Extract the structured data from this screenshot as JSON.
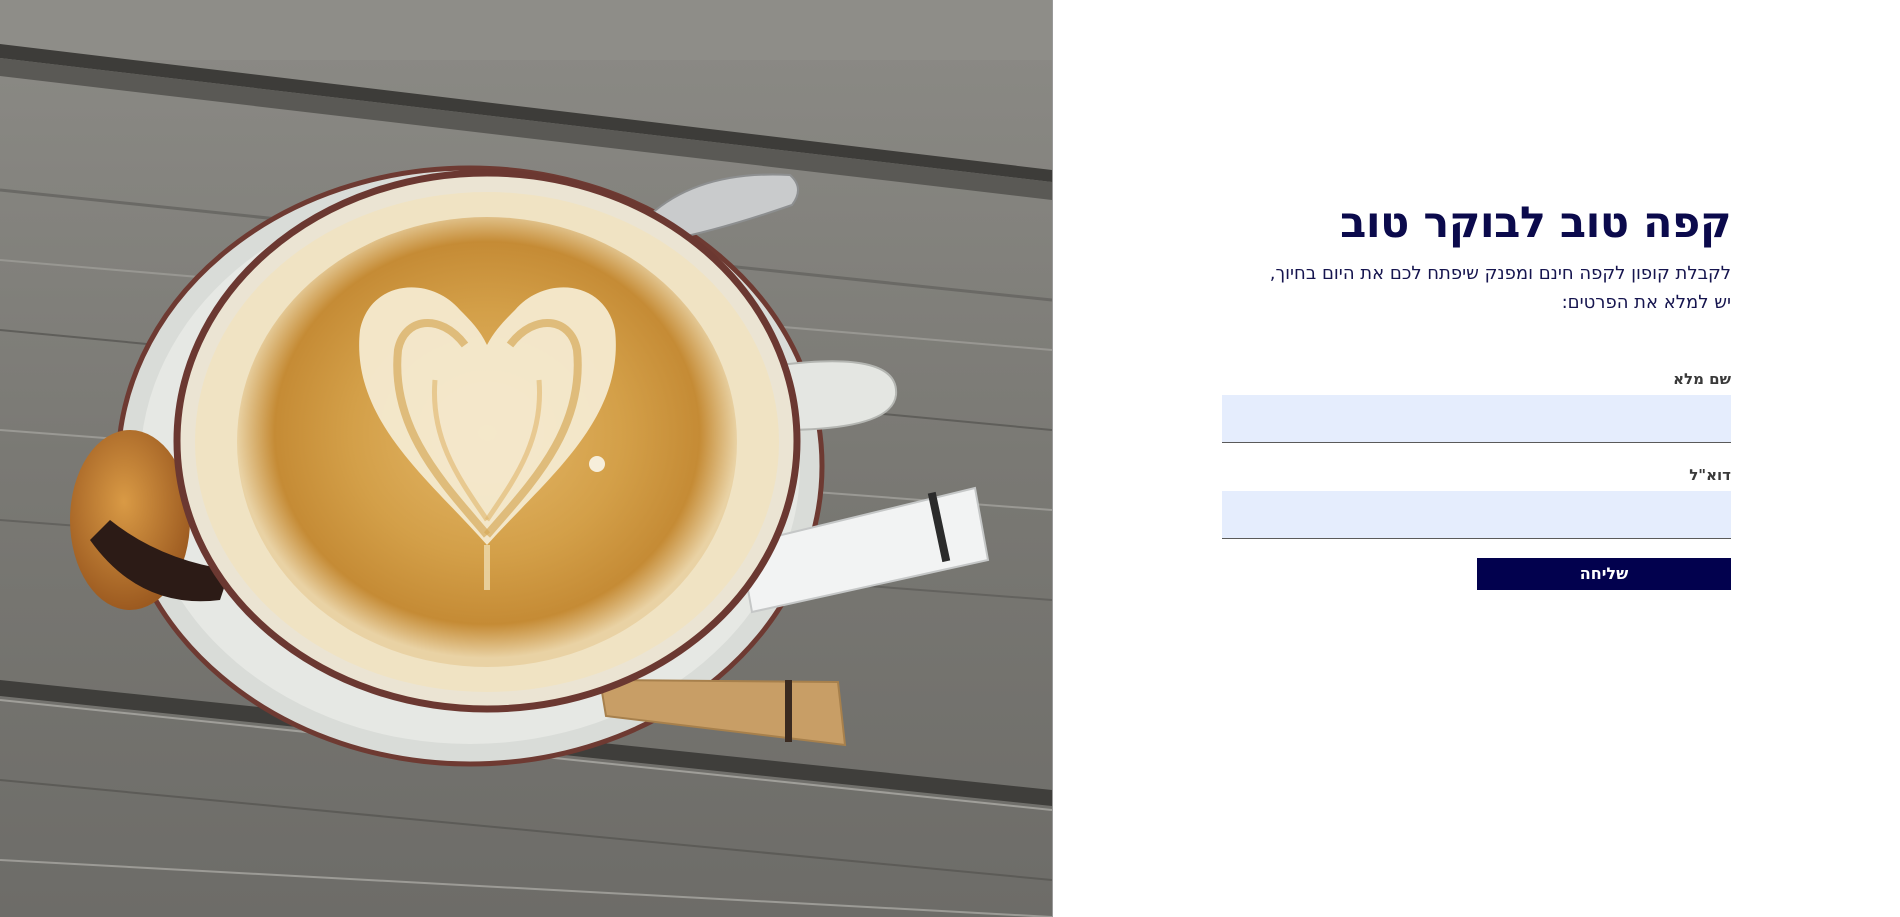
{
  "hero": {
    "title": "קפה טוב לבוקר טוב",
    "subtitle_line1": "לקבלת קופון לקפה חינם ומפנק שיפתח לכם את היום בחיוך,",
    "subtitle_line2": "יש למלא את הפרטים:"
  },
  "form": {
    "name_label": "שם מלא",
    "name_value": "",
    "email_label": "דוא\"ל",
    "email_value": "",
    "submit_label": "שליחה"
  },
  "colors": {
    "title": "#0b0a4c",
    "button_bg": "#02014e",
    "input_bg": "#e5edfd"
  }
}
